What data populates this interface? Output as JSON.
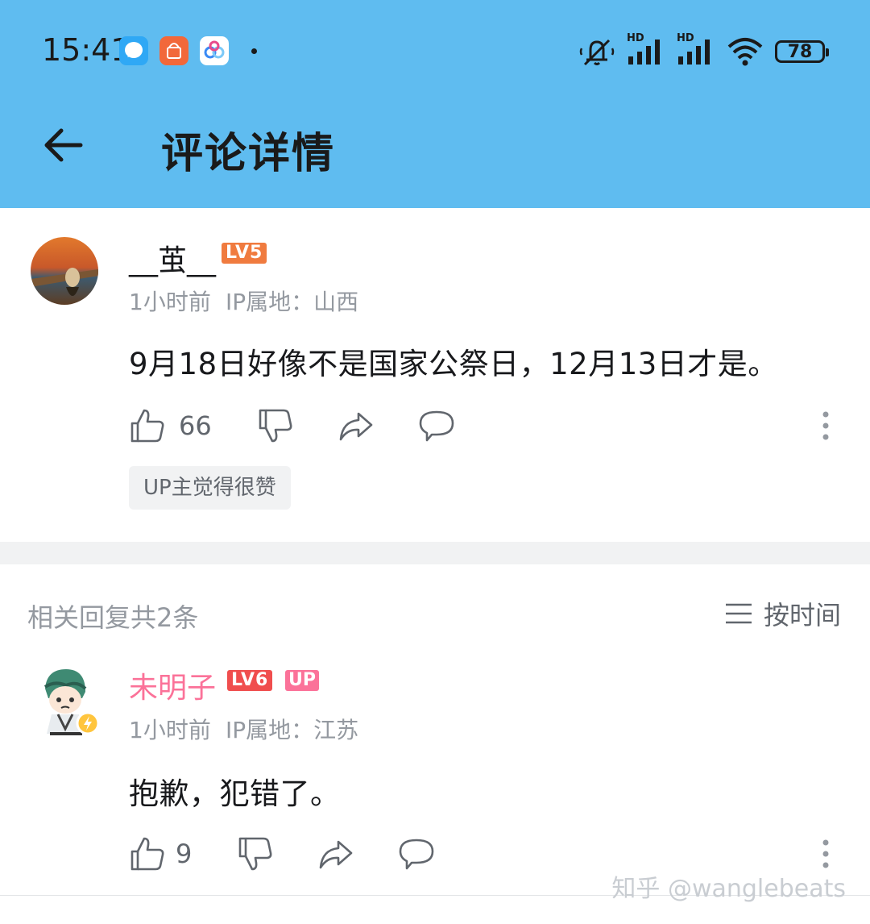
{
  "status_bar": {
    "time": "15:41",
    "battery": "78",
    "signal_label_1": "HD",
    "signal_label_2": "HD",
    "icons": [
      "messenger-app-icon",
      "mi-store-app-icon",
      "baidu-netdisk-app-icon",
      "mute-icon",
      "signal-icon",
      "signal-icon",
      "wifi-icon",
      "battery-icon"
    ]
  },
  "header": {
    "title": "评论详情",
    "back_icon": "arrow-left-icon"
  },
  "main_comment": {
    "username": "__茧__",
    "level": "LV5",
    "level_color": "#f07b3f",
    "time": "1小时前",
    "ip_location": "IP属地：山西",
    "text": "9月18日好像不是国家公祭日，12月13日才是。",
    "likes": "66",
    "up_liked_label": "UP主觉得很赞"
  },
  "replies_section": {
    "count_label": "相关回复共2条",
    "sort_label": "按时间"
  },
  "replies": [
    {
      "username": "未明子",
      "username_color": "#fb7299",
      "level": "LV6",
      "level_color": "#f04e4e",
      "tag": "UP",
      "time": "1小时前",
      "ip_location": "IP属地：江苏",
      "text": "抱歉，犯错了。",
      "likes": "9"
    }
  ],
  "watermark": "知乎 @wanglebeats"
}
